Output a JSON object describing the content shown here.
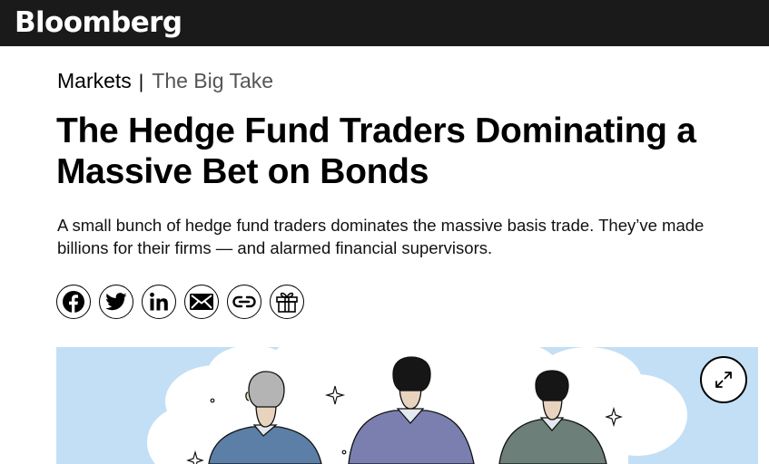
{
  "header": {
    "logo": "Bloomberg"
  },
  "breadcrumb": {
    "section": "Markets",
    "separator": "|",
    "series": "The Big Take"
  },
  "article": {
    "headline": "The Hedge Fund Traders Dominating a Massive Bet on Bonds",
    "dek": "A small bunch of hedge fund traders dominates the massive basis trade. They’ve made billions for their firms — and alarmed financial supervisors."
  },
  "share_icons": [
    "facebook-icon",
    "twitter-icon",
    "linkedin-icon",
    "email-icon",
    "link-icon",
    "gift-icon"
  ],
  "hero": {
    "expand_icon": "expand-icon"
  },
  "colors": {
    "topbar": "#1a1a1a",
    "hero_sky": "#c2dff5",
    "text": "#000000"
  }
}
